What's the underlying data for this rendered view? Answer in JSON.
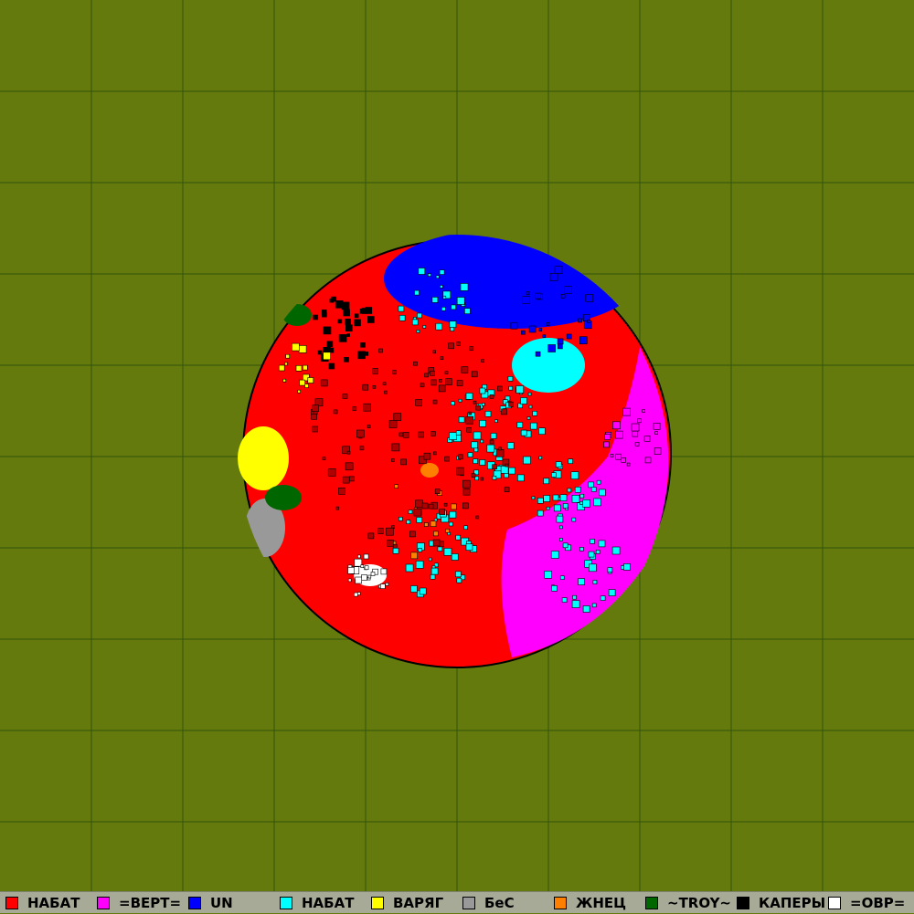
{
  "map": {
    "background_color": "#647a0c",
    "grid_color": "#33540a",
    "grid_cells": 10,
    "territory_base_color": "#ff0000",
    "territory_border_color": "#000000"
  },
  "legend": [
    {
      "label": "НАБАТ",
      "color": "#ff0000"
    },
    {
      "label": "=ВЕРТ=",
      "color": "#ff00ff"
    },
    {
      "label": "UN",
      "color": "#0000ff"
    },
    {
      "label": "НАБАТ",
      "color": "#00ffff"
    },
    {
      "label": "ВАРЯГ",
      "color": "#ffff00"
    },
    {
      "label": "БеС",
      "color": "#999999"
    },
    {
      "label": "ЖНЕЦ",
      "color": "#ff8000"
    },
    {
      "label": "~TROY~",
      "color": "#006600"
    },
    {
      "label": "КАПЕРЫ",
      "color": "#000000"
    },
    {
      "label": "=ОВР=",
      "color": "#ffffff"
    }
  ]
}
